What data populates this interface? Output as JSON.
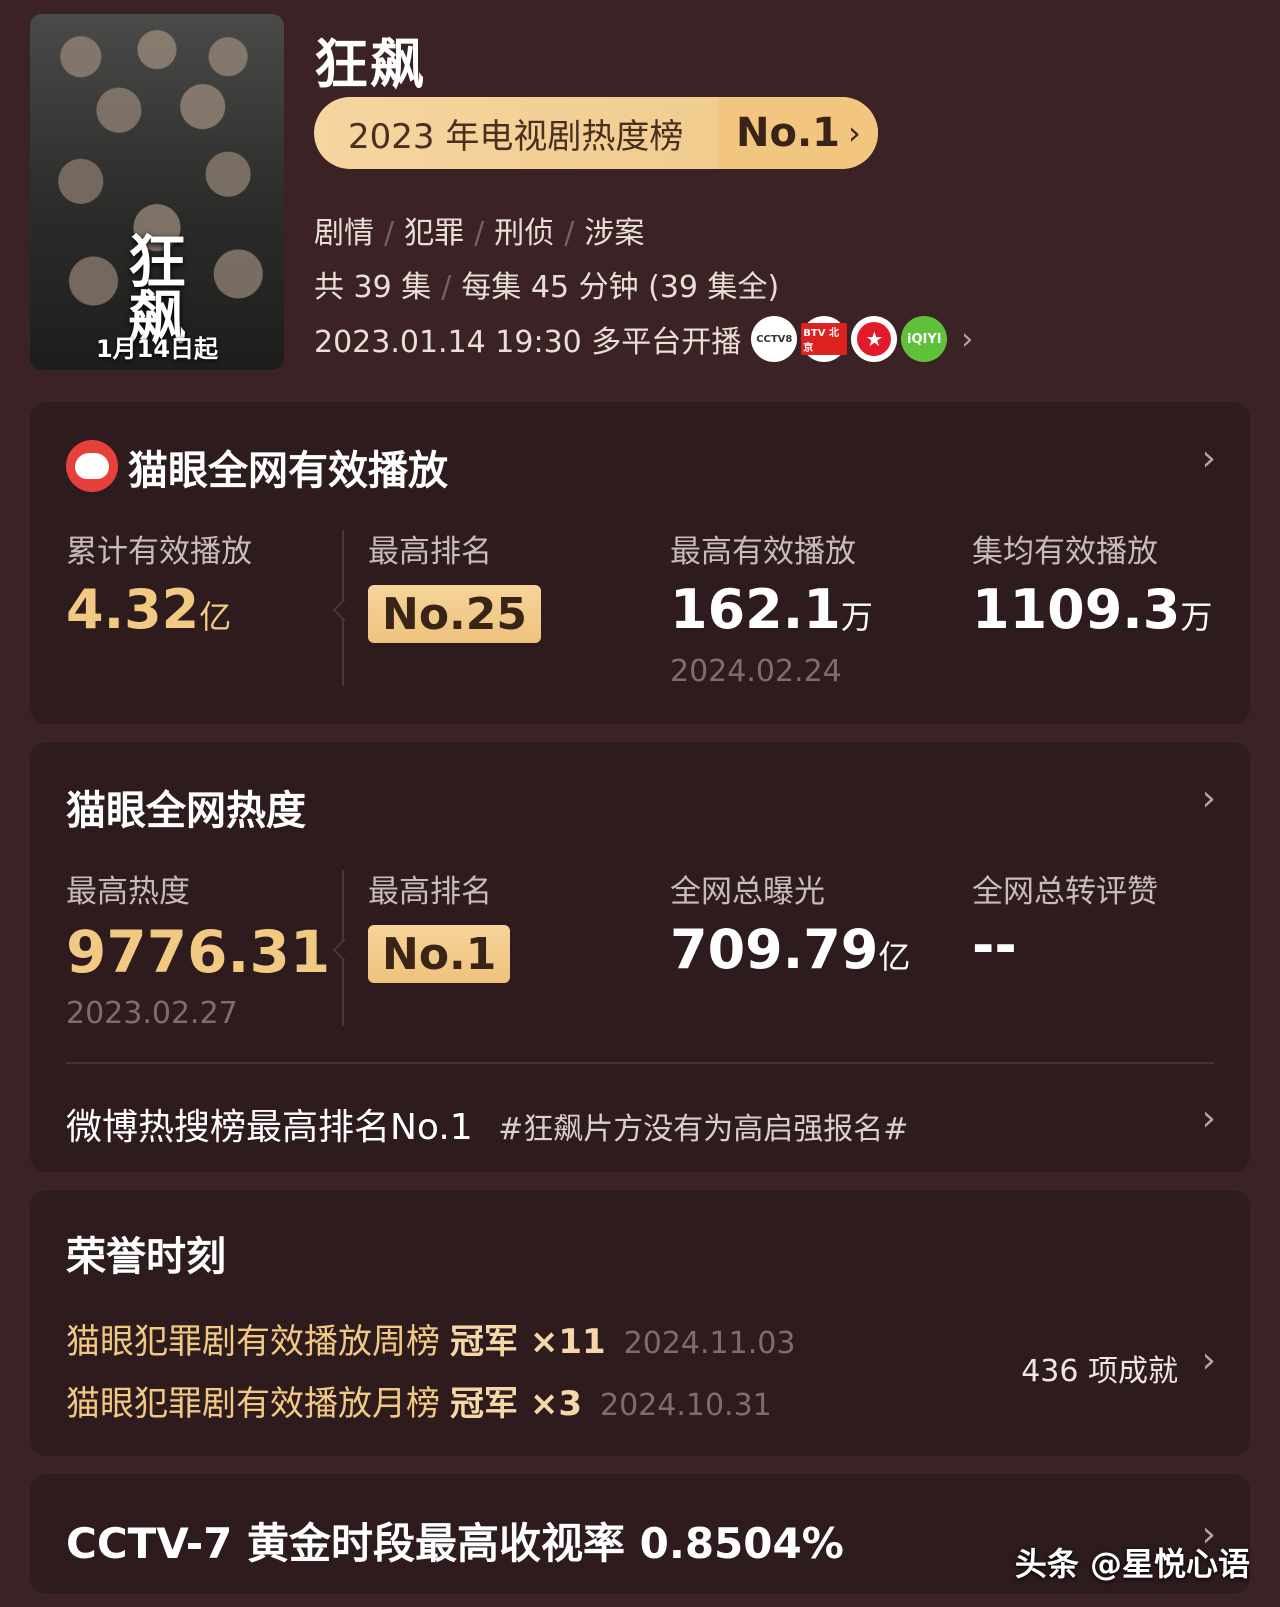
{
  "show": {
    "poster_title": "狂飙",
    "poster_date": "1月14日起",
    "title": "狂飙",
    "rank_label": "2023 年电视剧热度榜",
    "rank_value": "No.1",
    "genres": [
      "剧情",
      "犯罪",
      "刑侦",
      "涉案"
    ],
    "episodes": "共 39 集",
    "duration": "每集 45 分钟 (39 集全)",
    "release": "2023.01.14 19:30 多平台开播",
    "platforms": [
      {
        "name": "cctv8-icon",
        "text": "CCTV8"
      },
      {
        "name": "btv-icon",
        "text": "BTV 北京"
      },
      {
        "name": "dragon-tv-icon",
        "text": "★"
      },
      {
        "name": "iqiyi-icon",
        "text": "iQIYI"
      }
    ]
  },
  "playback": {
    "title": "猫眼全网有效播放",
    "total_label": "累计有效播放",
    "total_value": "4.32",
    "total_unit": "亿",
    "rank_label": "最高排名",
    "rank_value": "No.25",
    "peak_label": "最高有效播放",
    "peak_value": "162.1",
    "peak_unit": "万",
    "peak_date": "2024.02.24",
    "avg_label": "集均有效播放",
    "avg_value": "1109.3",
    "avg_unit": "万"
  },
  "heat": {
    "title": "猫眼全网热度",
    "peak_label": "最高热度",
    "peak_value": "9776.31",
    "peak_date": "2023.02.27",
    "rank_label": "最高排名",
    "rank_value": "No.1",
    "exposure_label": "全网总曝光",
    "exposure_value": "709.79",
    "exposure_unit": "亿",
    "engage_label": "全网总转评赞",
    "engage_value": "--",
    "weibo_text": "微博热搜榜最高排名No.1",
    "weibo_tag": "#狂飙片方没有为高启强报名#"
  },
  "honors": {
    "title": "荣誉时刻",
    "items": [
      {
        "text": "猫眼犯罪剧有效播放周榜",
        "award": "冠军 ×11",
        "date": "2024.11.03"
      },
      {
        "text": "猫眼犯罪剧有效播放月榜",
        "award": "冠军 ×3",
        "date": "2024.10.31"
      }
    ],
    "achievements": "436 项成就"
  },
  "ratings": {
    "text": "CCTV-7 黄金时段最高收视率 0.8504%"
  },
  "watermark": "头条 @星悦心语",
  "chevron": "›"
}
